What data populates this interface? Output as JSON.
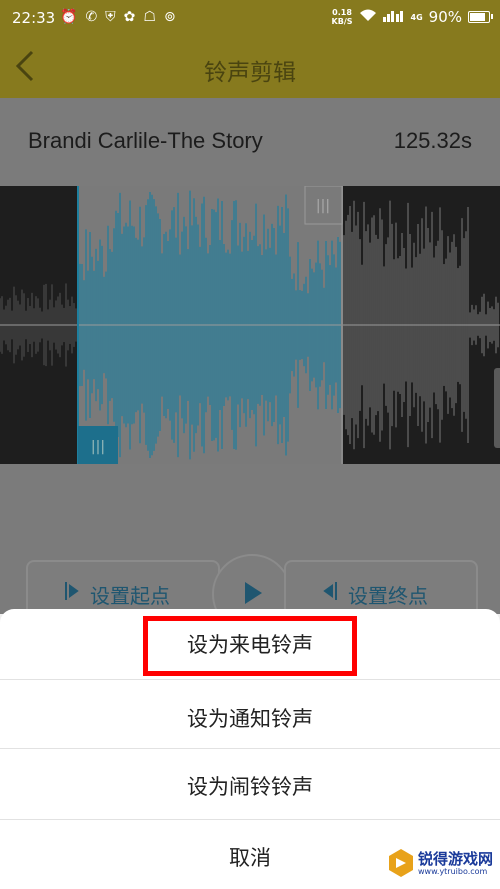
{
  "status_bar": {
    "time": "22:33",
    "net_speed_value": "0.18",
    "net_speed_unit": "KB/S",
    "network_type": "4G",
    "battery": "90%",
    "battery_level": 0.9,
    "left_icons": [
      "alarm-icon",
      "sim-icon",
      "shield-icon",
      "paw-icon",
      "ghost-icon",
      "netease-icon"
    ]
  },
  "app_bar": {
    "title": "铃声剪辑"
  },
  "song": {
    "name": "Brandi Carlile-The Story",
    "duration": "125.32s"
  },
  "controls": {
    "set_start_label": "设置起点",
    "set_end_label": "设置终点"
  },
  "sheet": {
    "options": [
      {
        "label": "设为来电铃声",
        "highlighted": true
      },
      {
        "label": "设为通知铃声"
      },
      {
        "label": "设为闹铃铃声"
      },
      {
        "label": "取消"
      }
    ]
  },
  "watermark": {
    "brand": "锐得游戏网",
    "url": "www.ytruibo.com"
  },
  "colors": {
    "appbar_dimmed": "#877a1e",
    "waveform_selected": "#1e7f9e",
    "highlight_border": "#ff0000"
  }
}
